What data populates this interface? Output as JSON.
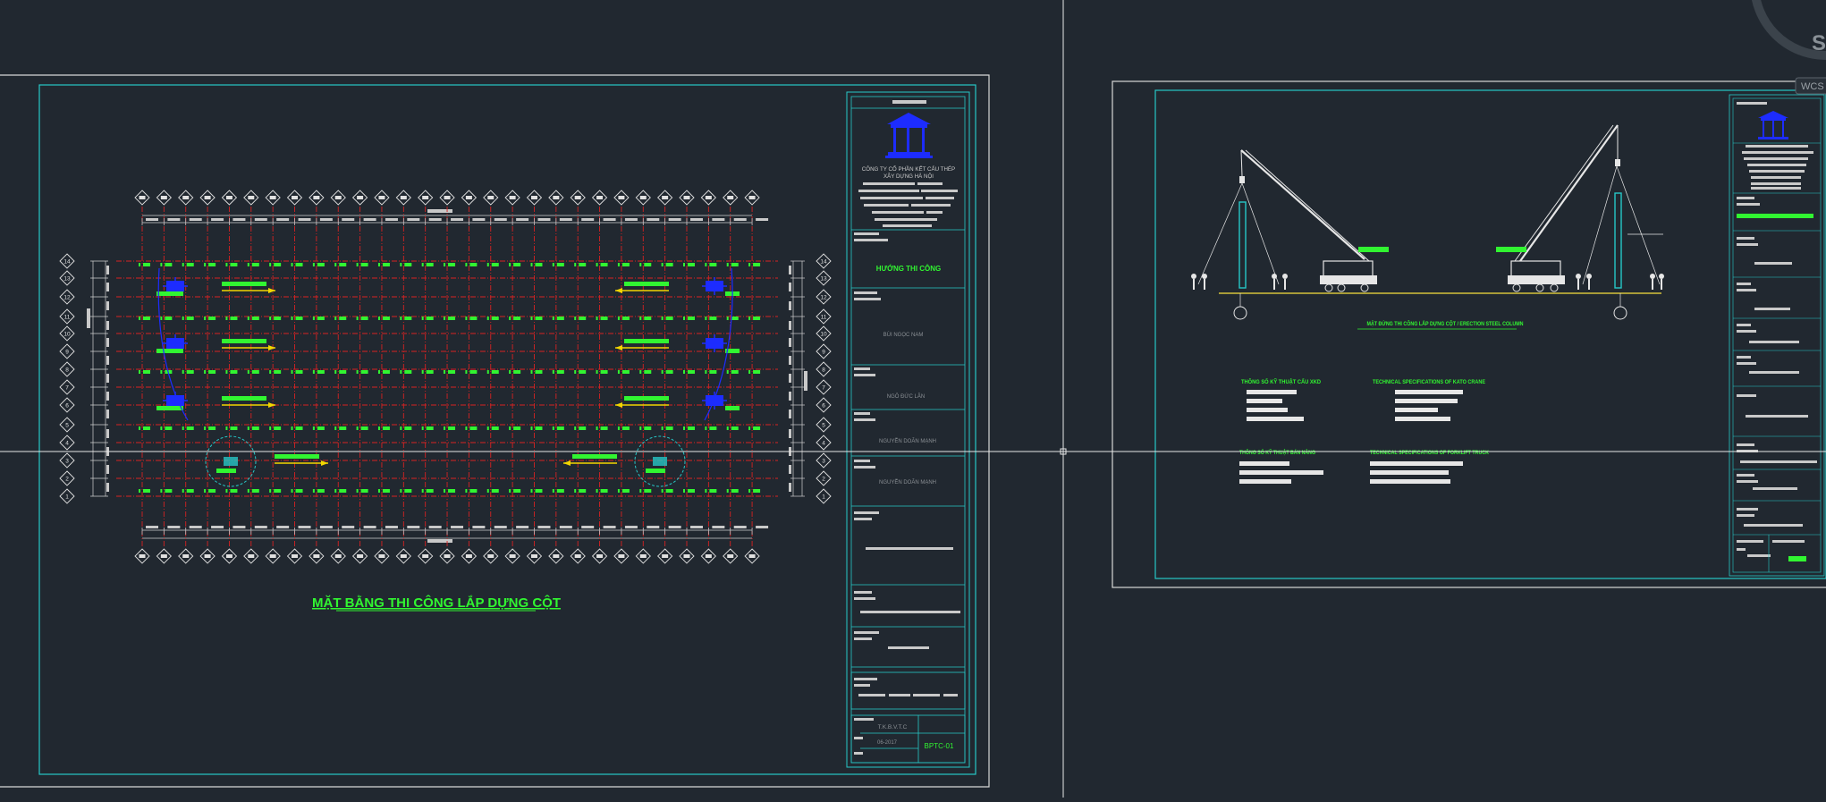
{
  "colors": {
    "background": "#212830",
    "border_white": "#d8d8d8",
    "border_cyan": "#27c7c7",
    "grid_red": "#d62222",
    "label_green": "#31f531",
    "crane_blue": "#1d2cff",
    "arrow_yellow": "#f2d600",
    "text_gray": "#9aa0a6"
  },
  "viewport": {
    "crosshair": {
      "name": "cad-crosshair-cursor"
    },
    "wcs_label": "WCS",
    "viewcube_letter": "S"
  },
  "sheet_left": {
    "drawing_title": "MẶT BẰNG THI CÔNG LẮP DỰNG CỘT",
    "title_block": {
      "company": "CÔNG TY CỔ PHẦN KẾT CẤU THÉP",
      "company_line2": "XÂY DỰNG HÀ NỘI",
      "section": "HƯỚNG THI CÔNG",
      "person1": "BÙI NGỌC NAM",
      "person2": "NGÔ ĐỨC LÂN",
      "person3": "NGUYỄN DOÃN MẠNH",
      "person4": "NGUYỄN DOÃN MẠNH",
      "stage_label": "T.K.B.V.T.C",
      "date": "06-2017",
      "sheet_code": "BPTC-01"
    },
    "row_axes": [
      "14",
      "13",
      "12",
      "11",
      "10",
      "9",
      "8",
      "7",
      "6",
      "5",
      "4",
      "3",
      "2",
      "1"
    ]
  },
  "sheet_right": {
    "elevation_title": "MẶT ĐỨNG THI CÔNG LẮP DỰNG CỘT / ERECTION STEEL COLUMN",
    "spec1_title": "THÔNG SỐ KỸ THUẬT CẨU XKD",
    "spec2_title": "TECHNICAL SPECIFICATIONS OF KATO CRANE",
    "spec3_title": "THÔNG SỐ KỸ THUẬT BÁN NÂNG",
    "spec4_title": "TECHNICAL SPECIFICATIONS OF FORKLIFT TRUCK"
  }
}
